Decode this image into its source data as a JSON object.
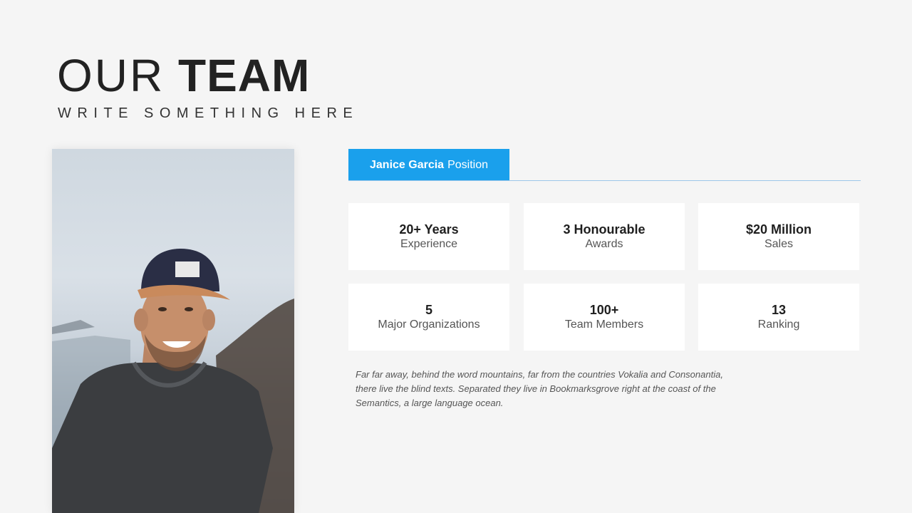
{
  "header": {
    "title_light": "OUR",
    "title_bold": "TEAM",
    "subtitle": "WRITE SOMETHING HERE"
  },
  "profile": {
    "name": "Janice Garcia",
    "position": "Position",
    "accent_color": "#1aa0ec"
  },
  "stats": [
    {
      "value": "20+ Years",
      "label": "Experience"
    },
    {
      "value": "3 Honourable",
      "label": "Awards"
    },
    {
      "value": "$20 Million",
      "label": "Sales"
    },
    {
      "value": "5",
      "label": "Major Organizations"
    },
    {
      "value": "100+",
      "label": "Team Members"
    },
    {
      "value": "13",
      "label": "Ranking"
    }
  ],
  "description": "Far far away, behind the word mountains, far from the countries Vokalia and Consonantia, there live the blind texts. Separated they live in Bookmarksgrove right at the coast of the Semantics, a large language ocean."
}
